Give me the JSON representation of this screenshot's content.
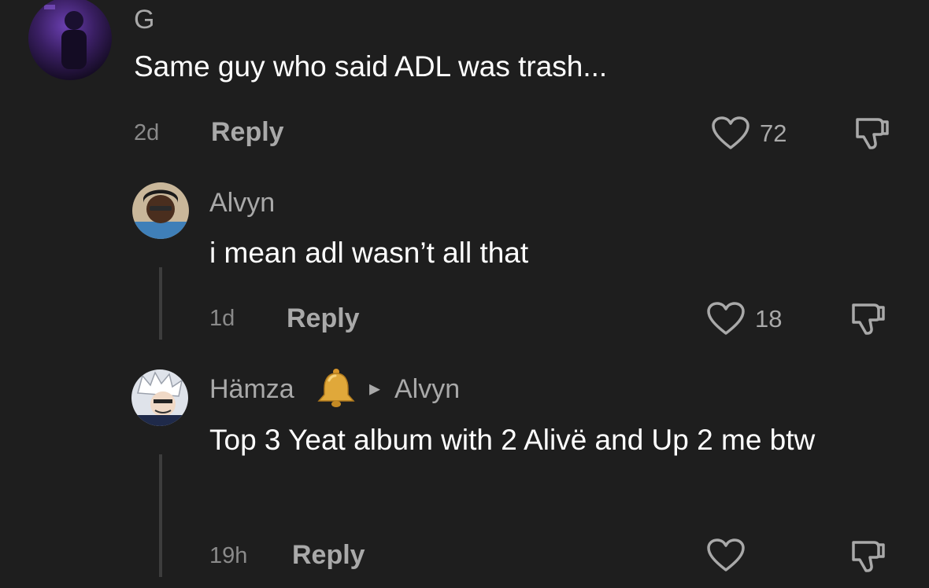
{
  "comments": [
    {
      "username": "G",
      "text": "Same guy who said ADL was trash...",
      "time": "2d",
      "reply_label": "Reply",
      "likes": "72"
    },
    {
      "username": "Alvyn",
      "text": "i mean adl wasn’t all that",
      "time": "1d",
      "reply_label": "Reply",
      "likes": "18"
    },
    {
      "username": "Hämza",
      "badge_icon": "bell-icon",
      "reply_to_arrow": "▸",
      "reply_to": "Alvyn",
      "text": "Top 3 Yeat album with 2 Alivë and Up 2 me btw",
      "time": "19h",
      "reply_label": "Reply",
      "likes": ""
    }
  ],
  "colors": {
    "background": "#1e1e1e",
    "text": "#ffffff",
    "secondary": "#a9a9a9",
    "thread_line": "#3d3d3d",
    "bell": "#e0a83a"
  }
}
